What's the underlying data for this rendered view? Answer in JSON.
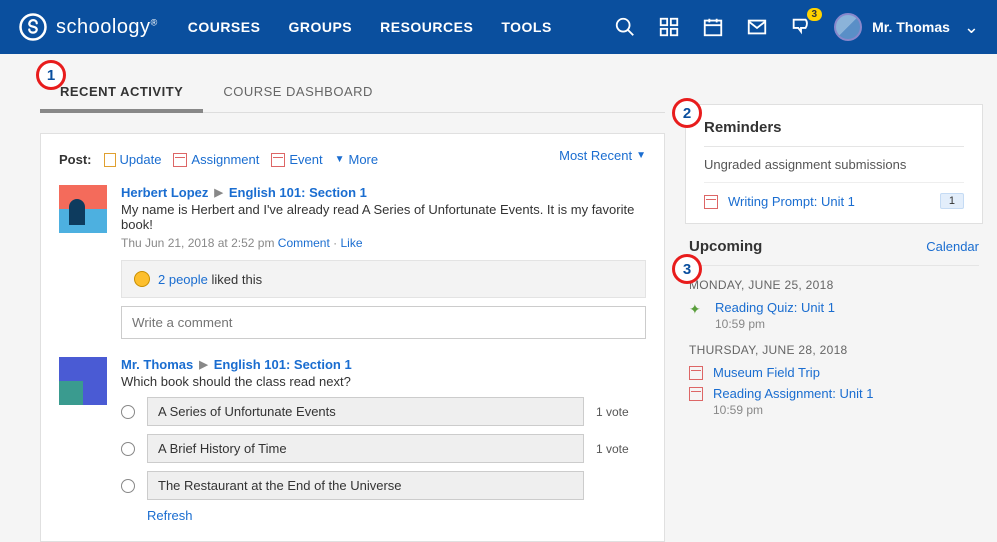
{
  "brand": "schoology",
  "nav": {
    "courses": "COURSES",
    "groups": "GROUPS",
    "resources": "RESOURCES",
    "tools": "TOOLS"
  },
  "notif_count": "3",
  "user": {
    "name": "Mr. Thomas"
  },
  "tabs": {
    "recent": "RECENT ACTIVITY",
    "dashboard": "COURSE DASHBOARD"
  },
  "post_bar": {
    "label": "Post:",
    "update": "Update",
    "assignment": "Assignment",
    "event": "Event",
    "more": "More",
    "sort": "Most Recent"
  },
  "feed": [
    {
      "author": "Herbert Lopez",
      "course": "English 101: Section 1",
      "body": "My name is Herbert and I've already read A Series of Unfortunate Events. It is my favorite book!",
      "timestamp": "Thu Jun 21, 2018 at 2:52 pm",
      "comment": "Comment",
      "like": "Like",
      "likes_text": "2 people",
      "likes_suffix": " liked this",
      "comment_placeholder": "Write a comment"
    },
    {
      "author": "Mr. Thomas",
      "course": "English 101: Section 1",
      "body": "Which book should the class read next?",
      "poll": [
        {
          "text": "A Series of Unfortunate Events",
          "votes": "1 vote"
        },
        {
          "text": "A Brief History of Time",
          "votes": "1 vote"
        },
        {
          "text": "The Restaurant at the End of the Universe",
          "votes": ""
        }
      ],
      "refresh": "Refresh"
    }
  ],
  "reminders": {
    "title": "Reminders",
    "subtitle": "Ungraded assignment submissions",
    "items": [
      {
        "title": "Writing Prompt: Unit 1",
        "count": "1"
      }
    ]
  },
  "upcoming": {
    "title": "Upcoming",
    "calendar": "Calendar",
    "groups": [
      {
        "date": "MONDAY, JUNE 25, 2018",
        "items": [
          {
            "title": "Reading Quiz: Unit 1",
            "time": "10:59 pm",
            "icon": "quiz"
          }
        ]
      },
      {
        "date": "THURSDAY, JUNE 28, 2018",
        "items": [
          {
            "title": "Museum Field Trip",
            "time": "",
            "icon": "cal"
          },
          {
            "title": "Reading Assignment: Unit 1",
            "time": "10:59 pm",
            "icon": "assign"
          }
        ]
      }
    ]
  },
  "annotations": {
    "a1": "1",
    "a2": "2",
    "a3": "3"
  }
}
